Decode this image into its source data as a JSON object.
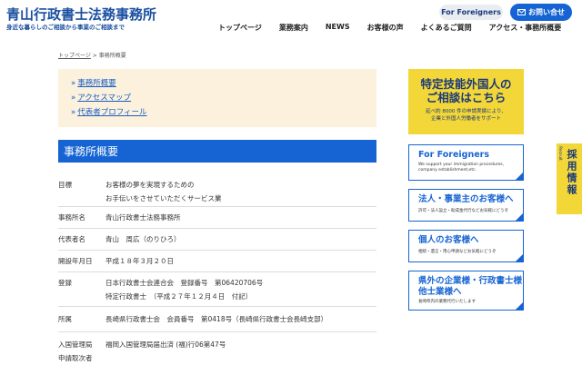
{
  "header": {
    "title": "青山行政書士法務事務所",
    "tagline": "身近な暮らしのご相談から事業のご相談まで",
    "foreigners_button": "For Foreigners",
    "contact_button": "お問い合せ",
    "nav": [
      "トップページ",
      "業務案内",
      "NEWS",
      "お客様の声",
      "よくあるご質問",
      "アクセス・事務所概要"
    ]
  },
  "breadcrumb": {
    "home": "トップページ",
    "separator": " > ",
    "current": "事務所概要"
  },
  "submenu": [
    "事務所概要",
    "アクセスマップ",
    "代表者プロフィール"
  ],
  "section_title": "事務所概要",
  "info": [
    {
      "label": [
        "目標"
      ],
      "value": [
        "お客様の夢を実現するための",
        "お手伝いをさせていただくサービス業"
      ]
    },
    {
      "label": [
        "事務所名"
      ],
      "value": [
        "青山行政書士法務事務所"
      ]
    },
    {
      "label": [
        "代表者名"
      ],
      "value": [
        "青山　周広（のりひろ）"
      ]
    },
    {
      "label": [
        "開設年月日"
      ],
      "value": [
        "平成１８年３月２０日"
      ]
    },
    {
      "label": [
        "登録"
      ],
      "value": [
        "日本行政書士会連合会　登録番号　第06420706号",
        "特定行政書士　（平成２７年１２月４日　付記）"
      ]
    },
    {
      "label": [
        "所属"
      ],
      "value": [
        "長崎県行政書士会　会員番号　第0418号（長崎県行政書士会長崎支部）"
      ]
    },
    {
      "label": [
        "入国管理局",
        "申請取次者"
      ],
      "value": [
        "福岡入国管理局届出済 (福)行06第47号"
      ]
    }
  ],
  "sidebar": {
    "main_banner": {
      "line1": "特定技能外国人の",
      "line2": "ご相談はこちら",
      "sub1": "延べ約 8000 件の申請実績により、",
      "sub2": "企業と外国人労働者をサポート"
    },
    "banners": [
      {
        "title": [
          "For Foreigners"
        ],
        "sub": [
          "We support your immigration procedures,",
          "company establishment,etc."
        ]
      },
      {
        "title": [
          "法人・事業主のお客様へ"
        ],
        "sub": [
          "許可・法人設立・助成金代行などお気軽にどうぞ"
        ]
      },
      {
        "title": [
          "個人のお客様へ"
        ],
        "sub": [
          "相続・遺言・用心申請などお気軽にどうぞ"
        ]
      },
      {
        "title": [
          "県外の企業様・行政書士様",
          "他士業様へ"
        ],
        "sub": [
          "長崎県内の業務代行いたします"
        ]
      }
    ]
  },
  "recruit": {
    "label": "Recruit",
    "text": "採用情報"
  },
  "colors": {
    "brand_blue": "#1664d3",
    "yellow": "#f3d638",
    "submenu_bg": "#fbf1dc"
  }
}
